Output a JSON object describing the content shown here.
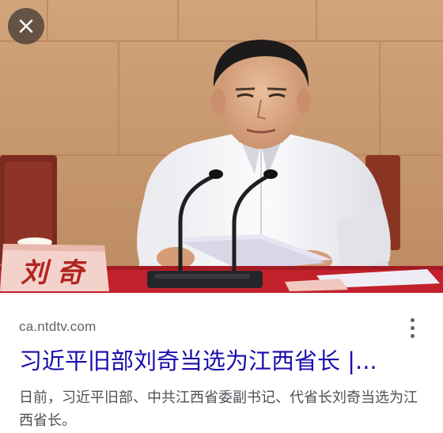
{
  "image": {
    "alt_icon": "photo",
    "nameplate_text": "刘 奇"
  },
  "close_button": {
    "icon": "close-icon"
  },
  "result": {
    "source": "ca.ntdtv.com",
    "title": "习近平旧部刘奇当选为江西省长 |...",
    "snippet": "日前，习近平旧部、中共江西省委副书记、代省长刘奇当选为江西省长。"
  },
  "more_button": {
    "icon": "more-vert-icon"
  },
  "colors": {
    "title_link": "#1a0dab",
    "source_text": "#5f6368",
    "snippet_text": "#4d5156",
    "wall": "#c9966a",
    "table_cloth": "#c2212b"
  }
}
